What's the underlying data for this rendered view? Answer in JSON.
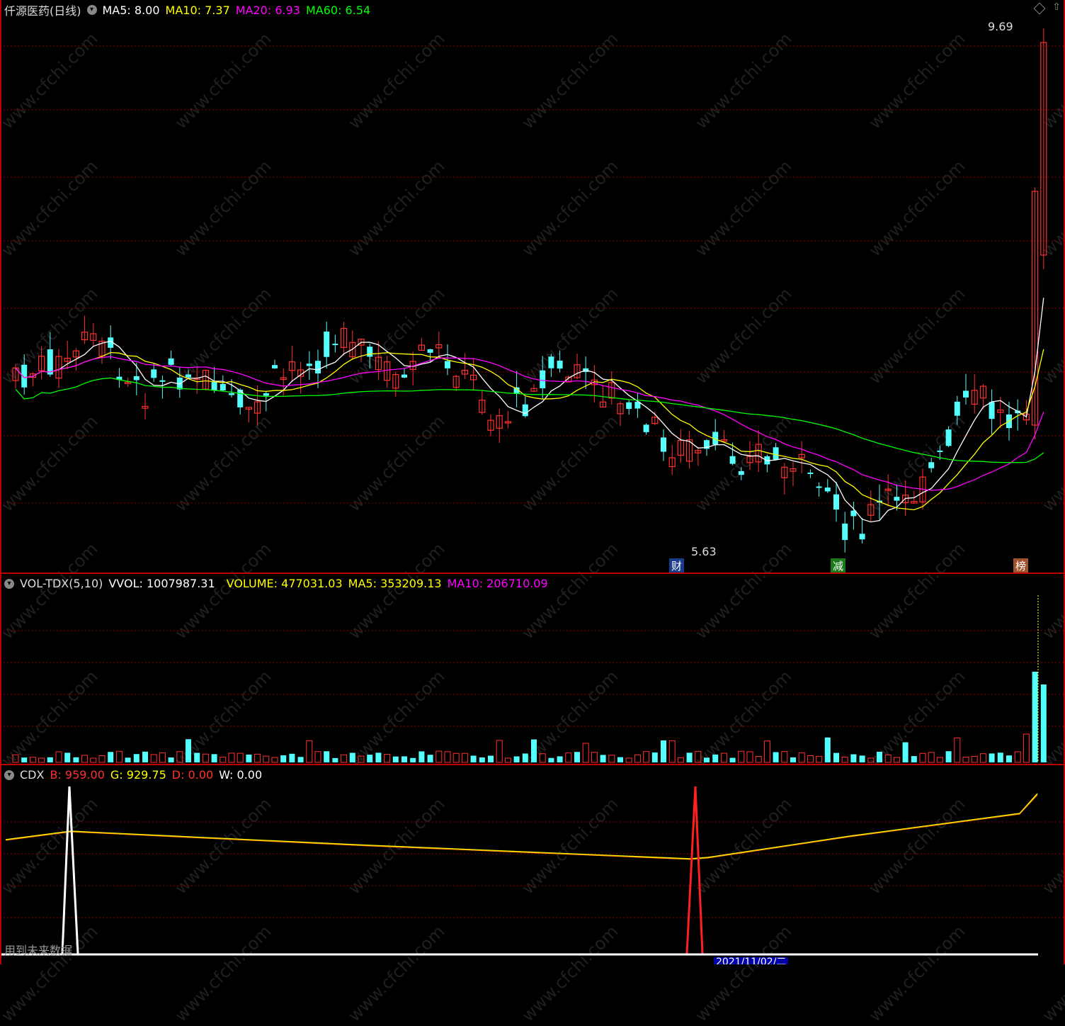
{
  "price_pane": {
    "title": "仟源医药(日线)",
    "indicators": [
      {
        "label": "MA5: 8.00",
        "color": "#ffffff"
      },
      {
        "label": "MA10: 7.37",
        "color": "#ffff00"
      },
      {
        "label": "MA20: 6.93",
        "color": "#ff00ff"
      },
      {
        "label": "MA60: 6.54",
        "color": "#00ff00"
      }
    ],
    "high_label": "9.69",
    "low_label": "5.63",
    "markers": [
      {
        "text": "财",
        "bg": "#1a3a8a"
      },
      {
        "text": "减",
        "bg": "#1a7a1a"
      },
      {
        "text": "榜",
        "bg": "#a0522d"
      }
    ]
  },
  "vol_pane": {
    "name": "VOL-TDX(5,10)",
    "vvol": "VVOL: 1007987.31",
    "volume": "VOLUME: 477031.03",
    "ma5": "MA5: 353209.13",
    "ma10": "MA10: 206710.09"
  },
  "cdx_pane": {
    "name": "CDX",
    "b": "B: 959.00",
    "g": "G: 929.75",
    "d": "D: 0.00",
    "w": "W: 0.00",
    "footnote": "用到未来数据",
    "date_label": "2021/11/02/二"
  },
  "colors": {
    "up": "#ff3030",
    "down": "#54ffff",
    "ma5": "#ffffff",
    "ma10": "#ffff00",
    "ma20": "#ff00ff",
    "ma60": "#00ff00",
    "grid": "#8b0000"
  },
  "watermark": "www.cfchi.com"
}
